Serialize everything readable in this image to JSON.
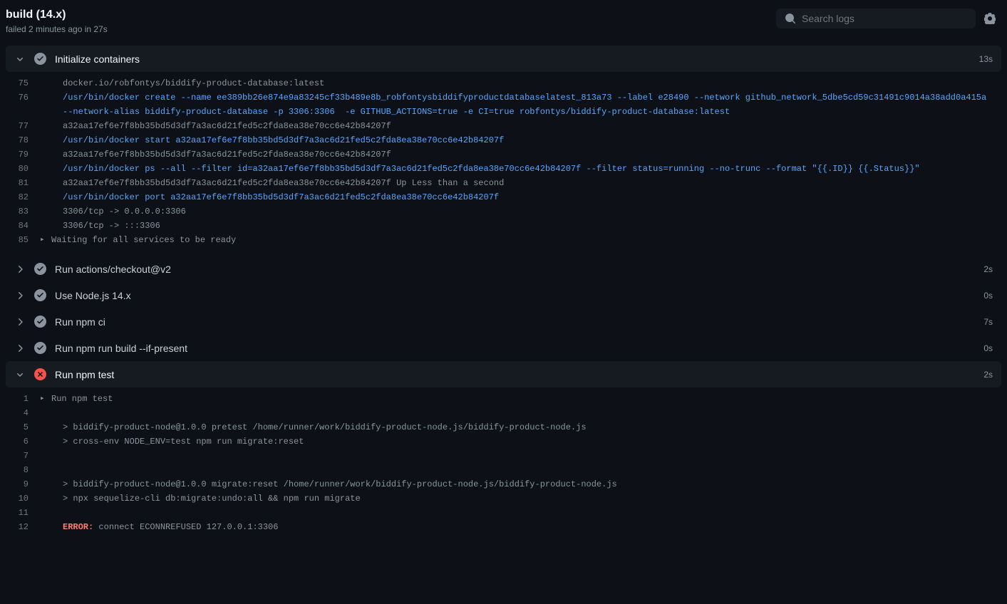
{
  "header": {
    "title": "build (14.x)",
    "subtitle": "failed 2 minutes ago in 27s",
    "search_placeholder": "Search logs"
  },
  "steps": [
    {
      "name": "Initialize containers",
      "duration": "13s",
      "status": "success",
      "expanded": true,
      "logs": [
        {
          "num": "75",
          "text": "docker.io/robfontys/biddify-product-database:latest",
          "cls": ""
        },
        {
          "num": "76",
          "text": "/usr/bin/docker create --name ee389bb26e874e9a83245cf33b489e8b_robfontysbiddifyproductdatabaselatest_813a73 --label e28490 --network github_network_5dbe5cd59c31491c9014a38add0a415a --network-alias biddify-product-database -p 3306:3306  -e GITHUB_ACTIONS=true -e CI=true robfontys/biddify-product-database:latest",
          "cls": "blue"
        },
        {
          "num": "77",
          "text": "a32aa17ef6e7f8bb35bd5d3df7a3ac6d21fed5c2fda8ea38e70cc6e42b84207f",
          "cls": ""
        },
        {
          "num": "78",
          "text": "/usr/bin/docker start a32aa17ef6e7f8bb35bd5d3df7a3ac6d21fed5c2fda8ea38e70cc6e42b84207f",
          "cls": "blue"
        },
        {
          "num": "79",
          "text": "a32aa17ef6e7f8bb35bd5d3df7a3ac6d21fed5c2fda8ea38e70cc6e42b84207f",
          "cls": ""
        },
        {
          "num": "80",
          "text": "/usr/bin/docker ps --all --filter id=a32aa17ef6e7f8bb35bd5d3df7a3ac6d21fed5c2fda8ea38e70cc6e42b84207f --filter status=running --no-trunc --format \"{{.ID}} {{.Status}}\"",
          "cls": "blue"
        },
        {
          "num": "81",
          "text": "a32aa17ef6e7f8bb35bd5d3df7a3ac6d21fed5c2fda8ea38e70cc6e42b84207f Up Less than a second",
          "cls": ""
        },
        {
          "num": "82",
          "text": "/usr/bin/docker port a32aa17ef6e7f8bb35bd5d3df7a3ac6d21fed5c2fda8ea38e70cc6e42b84207f",
          "cls": "blue"
        },
        {
          "num": "83",
          "text": "3306/tcp -> 0.0.0.0:3306",
          "cls": ""
        },
        {
          "num": "84",
          "text": "3306/tcp -> :::3306",
          "cls": ""
        },
        {
          "num": "85",
          "text": "Waiting for all services to be ready",
          "cls": "",
          "caret": true
        }
      ]
    },
    {
      "name": "Run actions/checkout@v2",
      "duration": "2s",
      "status": "success",
      "expanded": false
    },
    {
      "name": "Use Node.js 14.x",
      "duration": "0s",
      "status": "success",
      "expanded": false
    },
    {
      "name": "Run npm ci",
      "duration": "7s",
      "status": "success",
      "expanded": false
    },
    {
      "name": "Run npm run build --if-present",
      "duration": "0s",
      "status": "success",
      "expanded": false
    },
    {
      "name": "Run npm test",
      "duration": "2s",
      "status": "fail",
      "expanded": true,
      "logs": [
        {
          "num": "1",
          "text": "Run npm test",
          "cls": "",
          "caret": true
        },
        {
          "num": "4",
          "text": "",
          "cls": ""
        },
        {
          "num": "5",
          "text": "> biddify-product-node@1.0.0 pretest /home/runner/work/biddify-product-node.js/biddify-product-node.js",
          "cls": ""
        },
        {
          "num": "6",
          "text": "> cross-env NODE_ENV=test npm run migrate:reset",
          "cls": ""
        },
        {
          "num": "7",
          "text": "",
          "cls": ""
        },
        {
          "num": "8",
          "text": "",
          "cls": ""
        },
        {
          "num": "9",
          "text": "> biddify-product-node@1.0.0 migrate:reset /home/runner/work/biddify-product-node.js/biddify-product-node.js",
          "cls": ""
        },
        {
          "num": "10",
          "text": "> npx sequelize-cli db:migrate:undo:all && npm run migrate",
          "cls": ""
        },
        {
          "num": "11",
          "text": "",
          "cls": ""
        },
        {
          "num": "12",
          "text": "connect ECONNREFUSED 127.0.0.1:3306",
          "cls": "",
          "error": true
        }
      ]
    }
  ]
}
